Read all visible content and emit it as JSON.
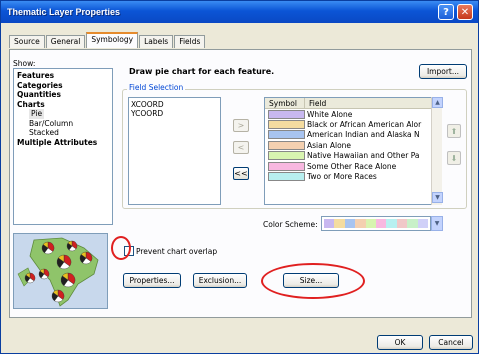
{
  "window": {
    "title": "Thematic Layer Properties",
    "help_glyph": "?",
    "close_glyph": "✕"
  },
  "tabs": [
    "Source",
    "General",
    "Symbology",
    "Labels",
    "Fields"
  ],
  "show": {
    "label": "Show:",
    "items": [
      "Features",
      "Categories",
      "Quantities",
      "Charts",
      "Pie",
      "Bar/Column",
      "Stacked",
      "Multiple Attributes"
    ]
  },
  "description": "Draw pie chart for each feature.",
  "import_label": "Import...",
  "field_selection": {
    "legend": "Field Selection",
    "available": [
      "XCOORD",
      "YCOORD"
    ],
    "move_buttons": [
      ">",
      "<",
      "<<"
    ],
    "columns": [
      "Symbol",
      "Field"
    ],
    "rows": [
      {
        "field": "White Alone",
        "color": "#c8b8f0"
      },
      {
        "field": "Black or African American Alor",
        "color": "#f4dca0"
      },
      {
        "field": "American Indian and Alaska N",
        "color": "#a8c4f0"
      },
      {
        "field": "Asian Alone",
        "color": "#f4d0b0"
      },
      {
        "field": "Native Hawaiian and Other Pa",
        "color": "#d8f4b0"
      },
      {
        "field": "Some Other Race Alone",
        "color": "#f8b8e0"
      },
      {
        "field": "Two or More Races",
        "color": "#b8f0f0"
      }
    ],
    "scroll_up": "▲",
    "scroll_down": "▼",
    "order_up": "⬆",
    "order_down": "⬇"
  },
  "color_scheme": {
    "label": "Color Scheme:",
    "colors": [
      "#c8b8f0",
      "#f4dca0",
      "#a8c4f0",
      "#f4d0b0",
      "#d8f4b0",
      "#f8b8e0",
      "#b8f0f0",
      "#f0c8c8",
      "#c8f0c8",
      "#d0d0f8"
    ],
    "dropdown_glyph": "▼"
  },
  "prevent_overlap_label": "Prevent chart overlap",
  "buttons": {
    "properties": "Properties...",
    "exclusion": "Exclusion...",
    "size": "Size...",
    "ok": "OK",
    "cancel": "Cancel"
  },
  "annotation_color": "#e02020"
}
